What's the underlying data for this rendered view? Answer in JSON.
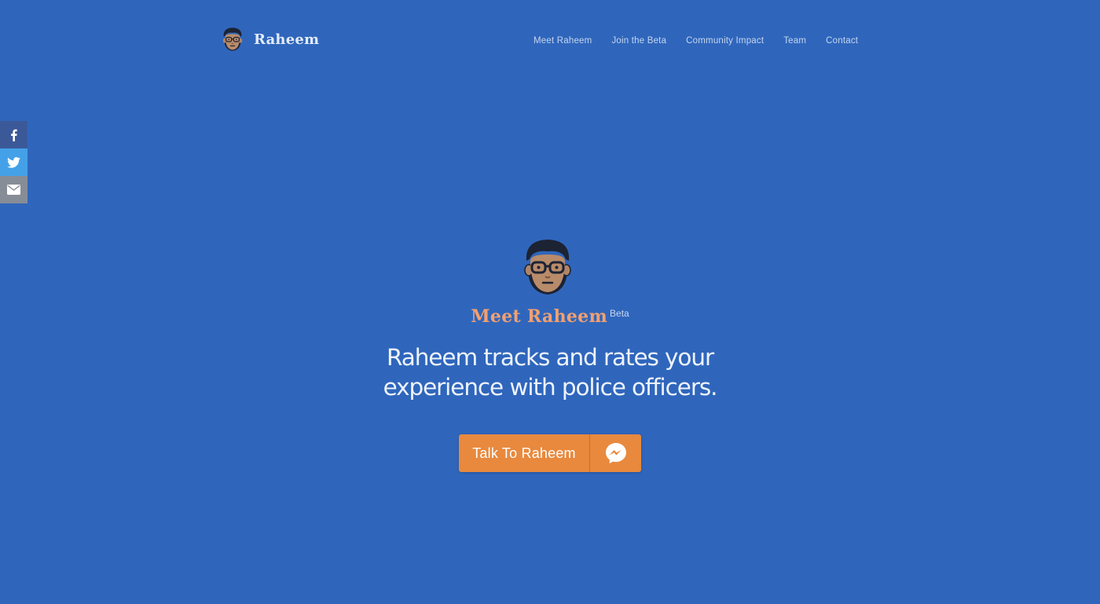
{
  "header": {
    "brand_name": "Raheem",
    "logo_icon": "raheem-avatar-icon",
    "nav": [
      {
        "label": "Meet Raheem"
      },
      {
        "label": "Join the Beta"
      },
      {
        "label": "Community Impact"
      },
      {
        "label": "Team"
      },
      {
        "label": "Contact"
      }
    ]
  },
  "share": {
    "items": [
      {
        "icon": "facebook-icon",
        "color": "#3b5998"
      },
      {
        "icon": "twitter-icon",
        "color": "#44a1e8"
      },
      {
        "icon": "email-icon",
        "color": "#878d96"
      }
    ]
  },
  "hero": {
    "avatar_icon": "raheem-avatar-icon",
    "title": "Meet Raheem",
    "badge": "Beta",
    "tagline_line1": "Raheem tracks and rates your",
    "tagline_line2": "experience with police officers.",
    "cta_label": "Talk To Raheem",
    "cta_icon": "messenger-icon"
  },
  "colors": {
    "background": "#2f66bc",
    "accent": "#e8893e",
    "title": "#f2a070"
  }
}
